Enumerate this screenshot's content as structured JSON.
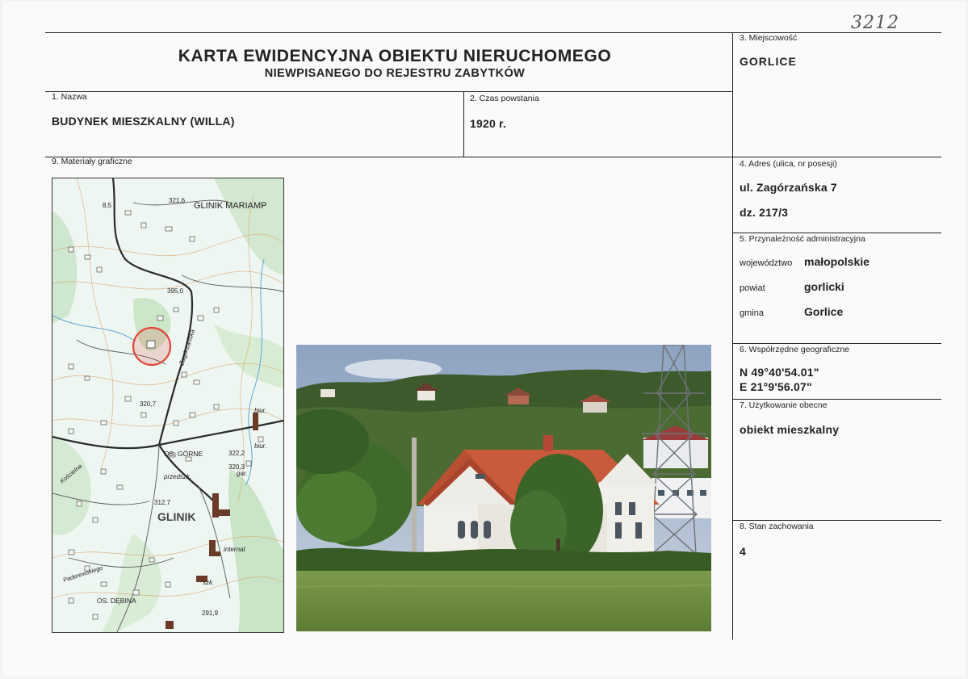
{
  "card": {
    "title": "KARTA EWIDENCYJNA OBIEKTU NIERUCHOMEGO",
    "subtitle": "NIEWPISANEGO DO REJESTRU ZABYTKÓW",
    "handwritten_number": "3212"
  },
  "fields": {
    "name_label": "1. Nazwa",
    "name_value": "BUDYNEK MIESZKALNY (WILLA)",
    "date_label": "2. Czas powstania",
    "date_value": "1920 r.",
    "locality_label": "3. Miejscowość",
    "locality_value": "GORLICE",
    "address_label": "4. Adres (ulica, nr posesji)",
    "address_line1": "ul. Zagórzańska 7",
    "address_line2": "dz. 217/3",
    "admin_label": "5. Przynależność administracyjna",
    "voivodeship_label": "województwo",
    "voivodeship_value": "małopolskie",
    "county_label": "powiat",
    "county_value": "gorlicki",
    "commune_label": "gmina",
    "commune_value": "Gorlice",
    "coords_label": "6. Współrzędne geograficzne",
    "coords_n": "N 49°40'54.01\"",
    "coords_e": "E 21°9'56.07\"",
    "usage_label": "7. Użytkowanie obecne",
    "usage_value": "obiekt mieszkalny",
    "condition_label": "8. Stan zachowania",
    "condition_value": "4",
    "graphics_label": "9. Materiały graficzne"
  },
  "map": {
    "labels": [
      "GLINIK MARIAMP",
      "GLINIK",
      "OS. GÓRNE",
      "OS. DĘBINA",
      "321,6",
      "395,0",
      "320,7",
      "322,2",
      "320,3",
      "312,7",
      "291,9",
      "przedszk.",
      "internat",
      "biur.",
      "szk.",
      "gar.",
      "Zagórzańska",
      "Kościelna",
      "Paderewskiego",
      "8,5"
    ],
    "marker_color": "#e0473a"
  }
}
